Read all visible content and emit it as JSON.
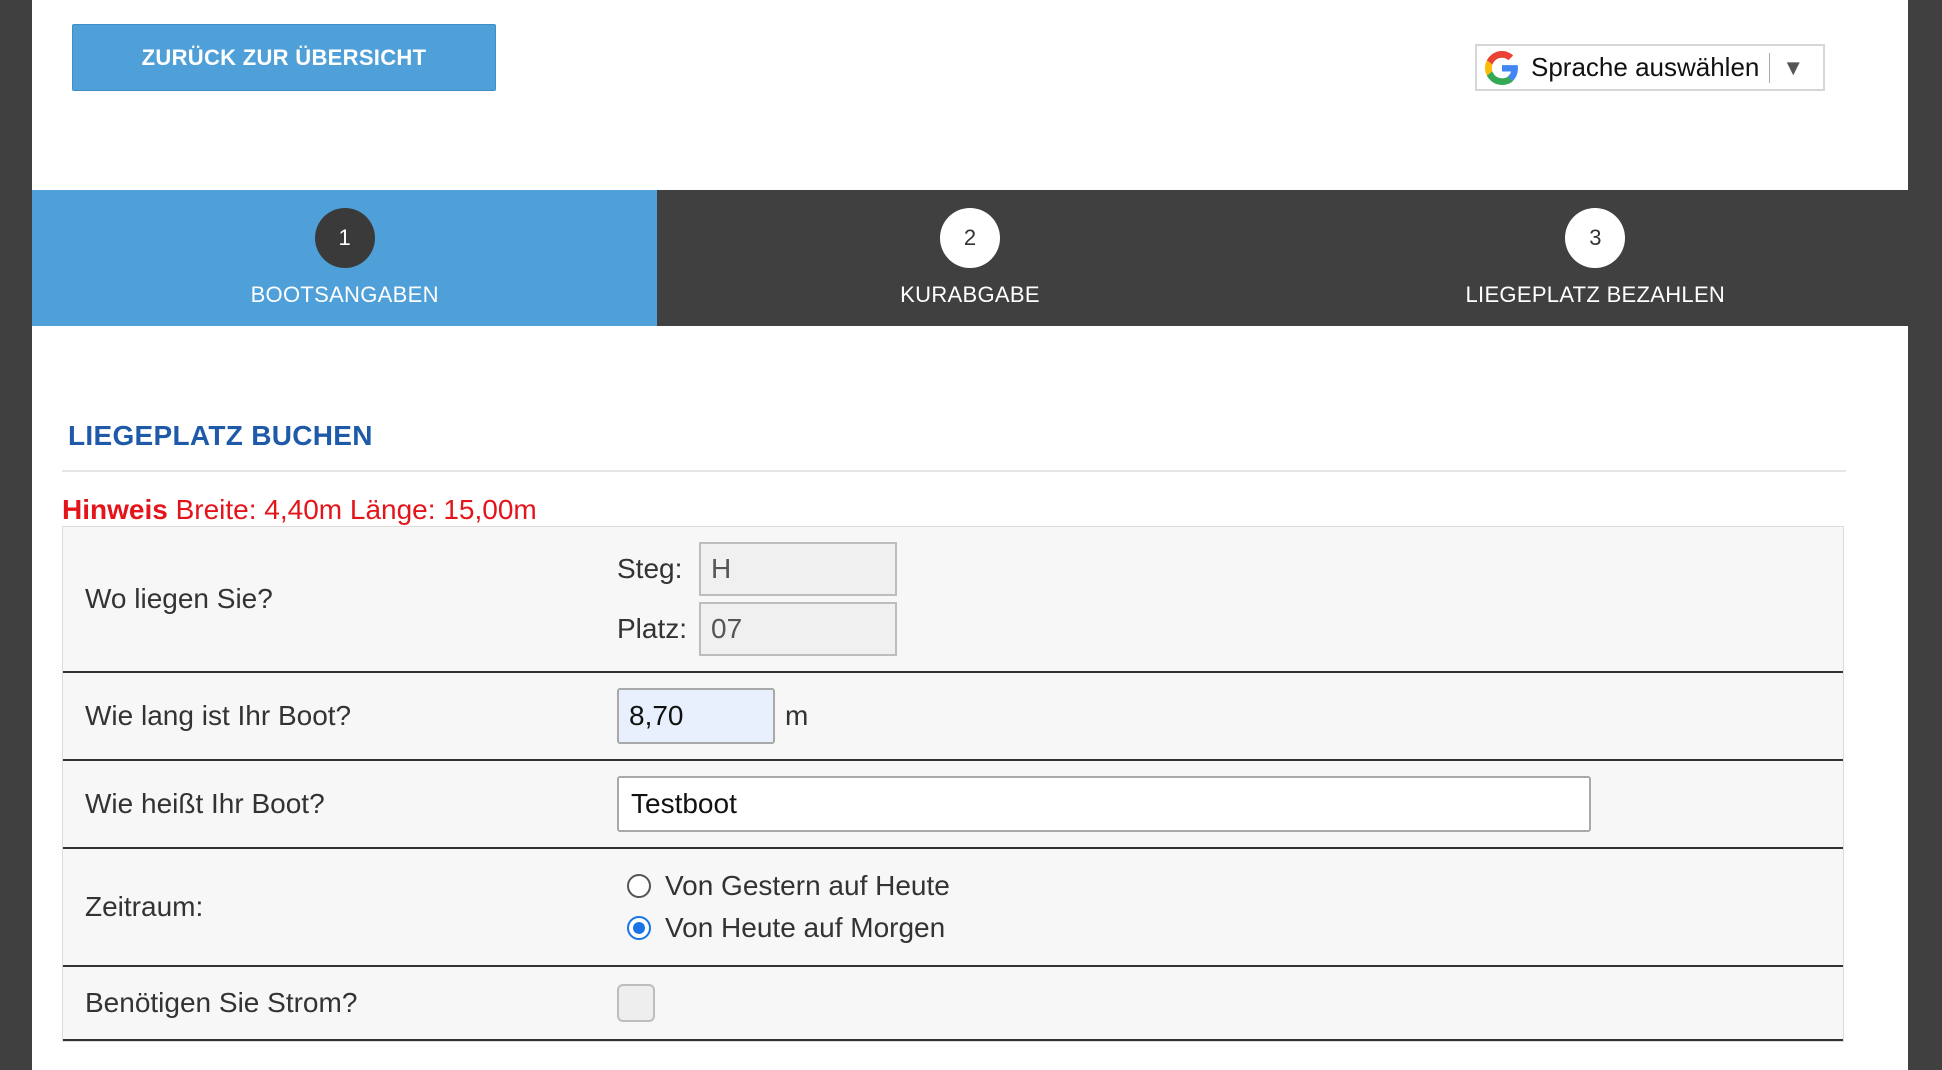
{
  "header": {
    "back_button_label": "ZURÜCK ZUR ÜBERSICHT",
    "language_select": {
      "label": "Sprache auswählen",
      "arrow": "▼",
      "icon": "google-g-icon"
    }
  },
  "steps": [
    {
      "number": "1",
      "label": "BOOTSANGABEN",
      "active": true
    },
    {
      "number": "2",
      "label": "KURABGABE",
      "active": false
    },
    {
      "number": "3",
      "label": "LIEGEPLATZ BEZAHLEN",
      "active": false
    }
  ],
  "section": {
    "title": "LIEGEPLATZ BUCHEN",
    "hint_label": "Hinweis",
    "hint_text": "Breite: 4,40m Länge: 15,00m"
  },
  "form": {
    "location": {
      "label": "Wo liegen Sie?",
      "steg_label": "Steg:",
      "steg_value": "H",
      "platz_label": "Platz:",
      "platz_value": "07"
    },
    "length": {
      "label": "Wie lang ist Ihr Boot?",
      "value": "8,70",
      "unit": "m"
    },
    "name": {
      "label": "Wie heißt Ihr Boot?",
      "value": "Testboot"
    },
    "period": {
      "label": "Zeitraum:",
      "options": [
        {
          "label": "Von Gestern auf Heute",
          "checked": false
        },
        {
          "label": "Von Heute auf Morgen",
          "checked": true
        }
      ]
    },
    "power": {
      "label": "Benötigen Sie Strom?",
      "checked": false
    }
  },
  "colors": {
    "accent": "#4fa0d8",
    "dark": "#404040",
    "title_blue": "#1f5aa8",
    "hint_red": "#e3151a"
  }
}
